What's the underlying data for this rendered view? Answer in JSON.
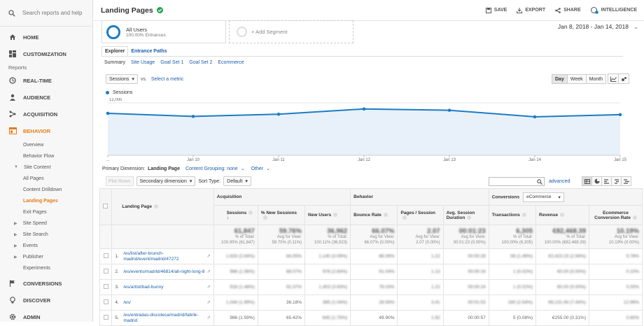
{
  "sidebar": {
    "search_placeholder": "Search reports and help",
    "home": "HOME",
    "customization": "CUSTOMIZATION",
    "reports_heading": "Reports",
    "realtime": "REAL-TIME",
    "audience": "AUDIENCE",
    "acquisition": "ACQUISITION",
    "behavior": "BEHAVIOR",
    "behavior_items": [
      "Overview",
      "Behavior Flow"
    ],
    "site_content": "Site Content",
    "site_content_items": [
      "All Pages",
      "Content Drilldown",
      "Landing Pages",
      "Exit Pages"
    ],
    "site_speed": "Site Speed",
    "site_search": "Site Search",
    "events": "Events",
    "publisher": "Publisher",
    "experiments": "Experiments",
    "conversions": "CONVERSIONS",
    "discover": "DISCOVER",
    "admin": "ADMIN",
    "accent": "#e67c13"
  },
  "header": {
    "title": "Landing Pages",
    "save": "SAVE",
    "export": "EXPORT",
    "share": "SHARE",
    "intelligence": "INTELLIGENCE",
    "intel_badge": "1"
  },
  "segments": {
    "name": "All Users",
    "sub": "100.00% Entrances",
    "add": "+ Add Segment"
  },
  "date_range": "Jan 8, 2018 - Jan 14, 2018",
  "tabs": [
    "Explorer",
    "Entrance Paths"
  ],
  "subtabs": [
    "Summary",
    "Site Usage",
    "Goal Set 1",
    "Goal Set 2",
    "Ecommerce"
  ],
  "metric": {
    "selected": "Sessions",
    "vs": "vs.",
    "select": "Select a metric"
  },
  "granularity": [
    "Day",
    "Week",
    "Month"
  ],
  "chart_data": {
    "type": "area",
    "series": [
      {
        "name": "Sessions",
        "values": [
          9600,
          8900,
          9400,
          10600,
          10300,
          8800,
          9300
        ]
      }
    ],
    "x": [
      "Jan 8",
      "Jan 9",
      "Jan 10",
      "Jan 11",
      "Jan 12",
      "Jan 13",
      "Jan 14"
    ],
    "xtick_labels": [
      "...",
      "Jan 10",
      "Jan 11",
      "Jan 12",
      "Jan 13",
      "Jan 14",
      "Jan 15"
    ],
    "ytick_labels": [
      "12,000",
      "6,000"
    ],
    "ylim": [
      0,
      12000
    ],
    "color": "#1c7cc4",
    "fill": "#e8f1f9"
  },
  "primary_dimension": {
    "label": "Primary Dimension:",
    "value": "Landing Page",
    "grouping": "Content Grouping: none",
    "other": "Other"
  },
  "controls": {
    "plot_rows": "Plot Rows",
    "secondary": "Secondary dimension",
    "sort_label": "Sort Type:",
    "sort_value": "Default",
    "advanced": "advanced"
  },
  "table": {
    "groups": {
      "acquisition": "Acquisition",
      "behavior": "Behavior",
      "conversions": "Conversions",
      "conv_select": "eCommerce"
    },
    "landing_page": "Landing Page",
    "columns": [
      "Sessions",
      "% New Sessions",
      "New Users",
      "Bounce Rate",
      "Pages / Session",
      "Avg. Session Duration",
      "Transactions",
      "Revenue",
      "Ecommerce Conversion Rate"
    ],
    "totals": [
      {
        "big": "61,847",
        "l1": "% of Total:",
        "l2": "100.00% (61,847)"
      },
      {
        "big": "59.76%",
        "l1": "Avg for View:",
        "l2": "59.70% (0.11%)"
      },
      {
        "big": "36,962",
        "l1": "% of Total:",
        "l2": "100.11% (36,923)"
      },
      {
        "big": "66.07%",
        "l1": "Avg for View:",
        "l2": "66.07% (0.00%)"
      },
      {
        "big": "2.07",
        "l1": "Avg for View:",
        "l2": "2.07 (0.00%)"
      },
      {
        "big": "00:01:23",
        "l1": "Avg for View:",
        "l2": "00:01:23 (0.00%)"
      },
      {
        "big": "6,305",
        "l1": "% of Total:",
        "l2": "100.00% (6,305)"
      },
      {
        "big": "€82,468.39",
        "l1": "% of Total:",
        "l2": "100.00% (€82,468.39)"
      },
      {
        "big": "10.19%",
        "l1": "Avg for View:",
        "l2": "10.19% (0.00%)"
      }
    ],
    "rows": [
      {
        "idx": "1.",
        "page": "/es/list/after-brunch-madrid/event/madrid/47272",
        "cells": [
          "1,633 (2.64%)",
          "84.05%",
          "1,140 (3.09%)",
          "86.06%",
          "1.22",
          "00:00:26",
          "56 (1.49%)",
          "€2,423.15 (2.94%)",
          "5.78%"
        ]
      },
      {
        "idx": "2.",
        "page": "/es/events/madrid/46814/all-night-long-8",
        "cells": [
          "966 (1.56%)",
          "68.07%",
          "978 (2.64%)",
          "91.04%",
          "1.13",
          "00:00:16",
          "1 (0.02%)",
          "€0.00 (0.00%)",
          "0.10%"
        ]
      },
      {
        "idx": "3.",
        "page": "/es/artist/bad-bunny",
        "cells": [
          "918 (1.48%)",
          "92.37%",
          "1,453 (3.93%)",
          "76.03%",
          "1.22",
          "00:00:24",
          "1 (0.02%)",
          "€0.00 (0.00%)",
          "0.00%"
        ]
      },
      {
        "idx": "4.",
        "page": "/es/",
        "cells": [
          "1,044 (1.69%)",
          "36.18%",
          "385 (1.04%)",
          "28.93%",
          "3.41",
          "00:01:53",
          "160 (2.54%)",
          "€6,131.94 (7.44%)",
          "12.96%"
        ]
      },
      {
        "idx": "5.",
        "page": "/es/entradas-discoteca/madrid/fabrik-madrid",
        "cells": [
          "986 (1.59%)",
          "65.42%",
          "645 (1.75%)",
          "49.90%",
          "1.92",
          "00:00:57",
          "5 (0.08%)",
          "€255.00 (0.31%)",
          "0.60%"
        ]
      }
    ],
    "clear_cells": {
      "4": [
        1
      ],
      "5": [
        0,
        1,
        3,
        5,
        6,
        7
      ]
    }
  }
}
